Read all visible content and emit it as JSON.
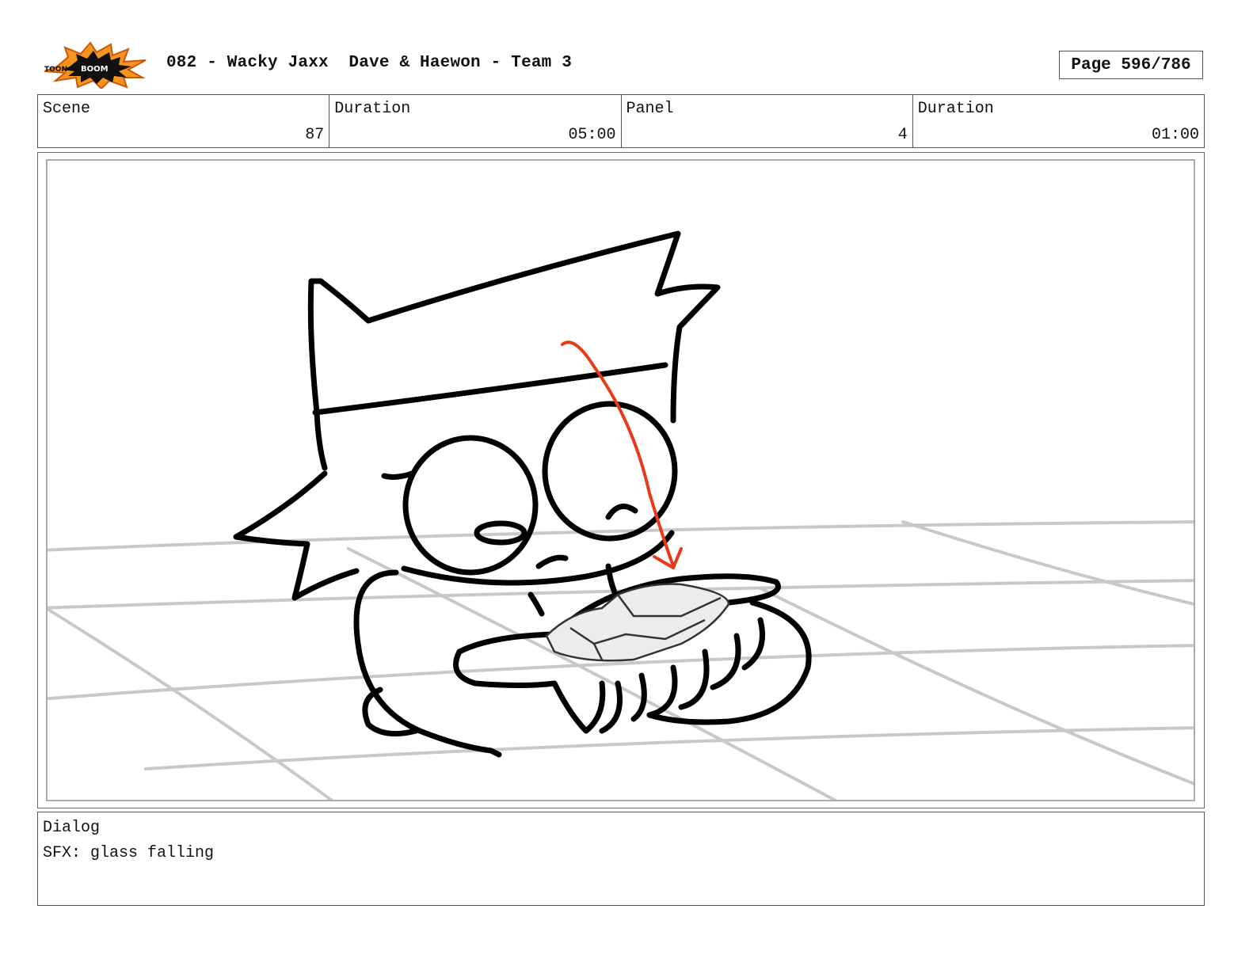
{
  "header": {
    "logo_text": "TOONBOOM",
    "title": "082 - Wacky Jaxx  Dave & Haewon - Team 3",
    "page": "Page 596/786"
  },
  "info": {
    "scene_label": "Scene",
    "scene_value": "87",
    "scene_duration_label": "Duration",
    "scene_duration_value": "05:00",
    "panel_label": "Panel",
    "panel_value": "4",
    "panel_duration_label": "Duration",
    "panel_duration_value": "01:00"
  },
  "panel": {
    "description_icon": "storyboard-drawing",
    "arrow_color": "#e8391b"
  },
  "dialog": {
    "label": "Dialog",
    "text": "SFX: glass falling"
  }
}
